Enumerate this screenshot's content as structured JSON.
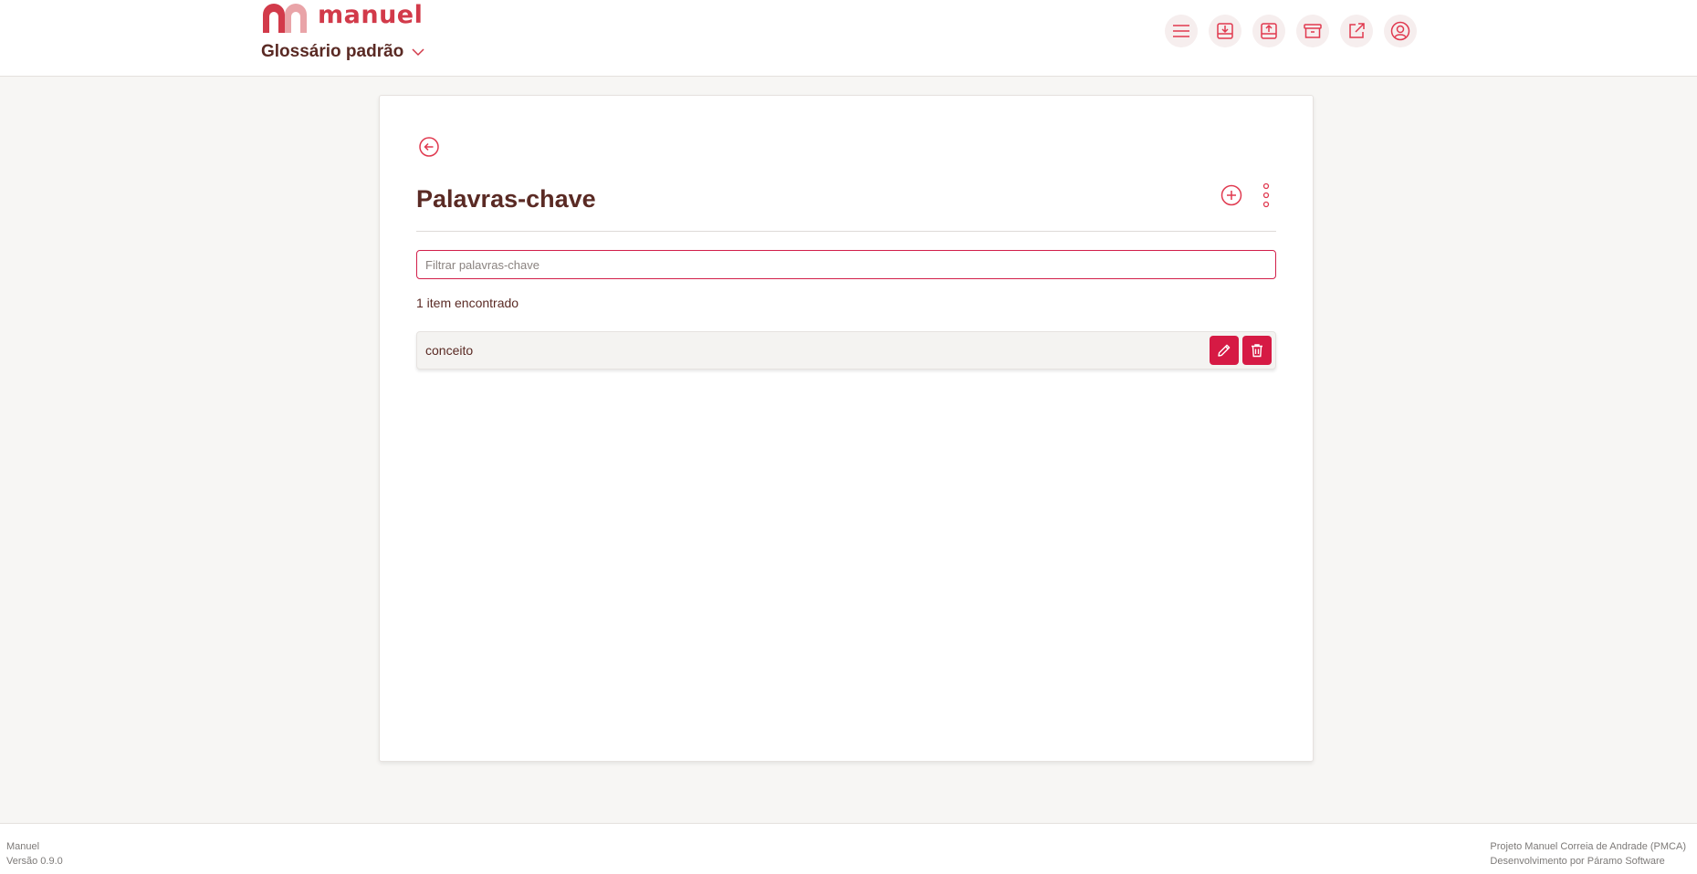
{
  "brand": {
    "name": "manuel",
    "primary_color": "#d61a44",
    "logo_color": "#d23a4a",
    "text_color": "#5a2a24"
  },
  "header": {
    "glossary_label": "Glossário padrão",
    "toolbar": [
      {
        "icon": "menu-icon"
      },
      {
        "icon": "import-icon"
      },
      {
        "icon": "export-icon"
      },
      {
        "icon": "archive-icon"
      },
      {
        "icon": "external-link-icon"
      },
      {
        "icon": "user-icon"
      }
    ]
  },
  "main": {
    "title": "Palavras-chave",
    "filter_placeholder": "Filtrar palavras-chave",
    "filter_value": "",
    "count_text": "1 item encontrado",
    "items": [
      {
        "label": "conceito"
      }
    ]
  },
  "footer": {
    "app_name": "Manuel",
    "version": "Versão 0.9.0",
    "project": "Projeto Manuel Correia de Andrade (PMCA)",
    "developer": "Desenvolvimento por Páramo Software"
  }
}
